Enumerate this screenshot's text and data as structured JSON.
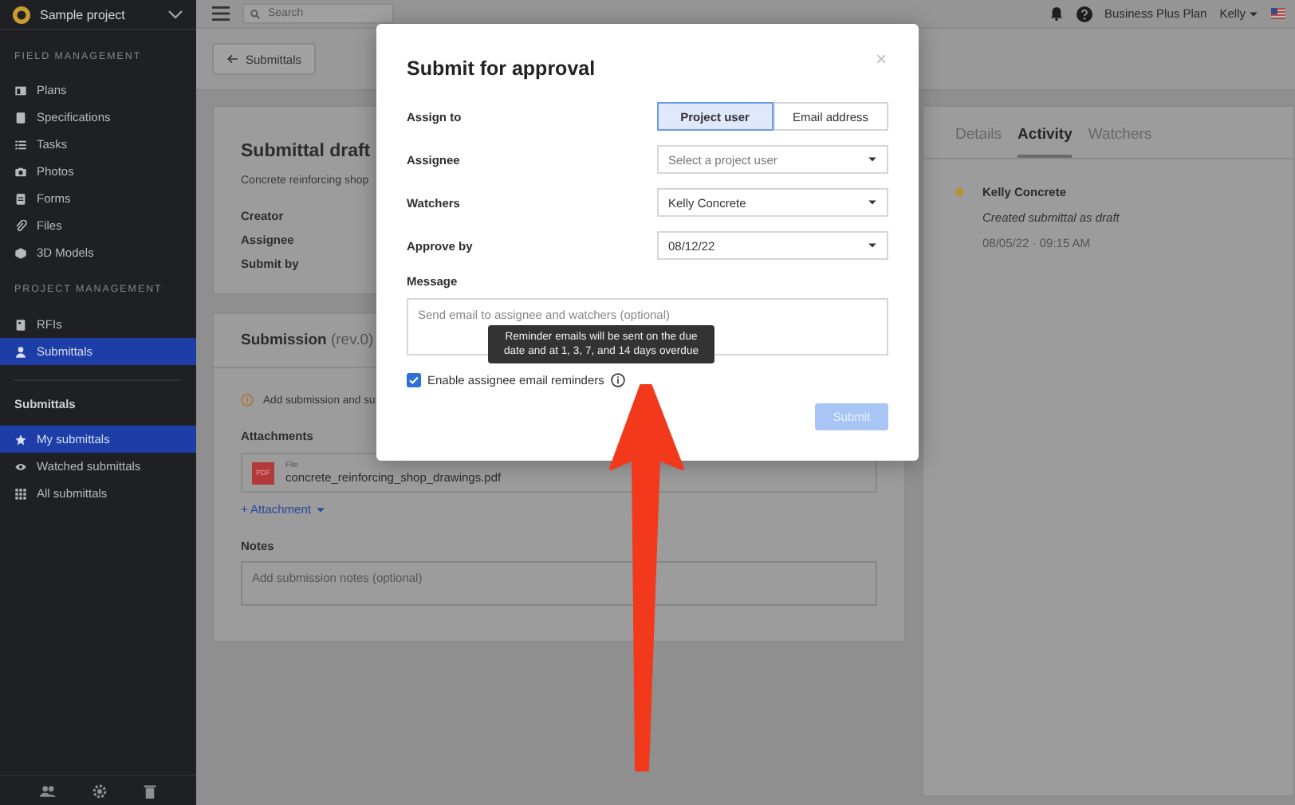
{
  "sidebar": {
    "project": "Sample project",
    "sections": [
      {
        "title": "FIELD MANAGEMENT",
        "items": [
          {
            "label": "Plans",
            "selected": false
          },
          {
            "label": "Specifications",
            "selected": false
          },
          {
            "label": "Tasks",
            "selected": false
          },
          {
            "label": "Photos",
            "selected": false
          },
          {
            "label": "Forms",
            "selected": false
          },
          {
            "label": "Files",
            "selected": false
          },
          {
            "label": "3D Models",
            "selected": false
          }
        ]
      },
      {
        "title": "PROJECT MANAGEMENT",
        "items": [
          {
            "label": "RFIs",
            "selected": false
          },
          {
            "label": "Submittals",
            "selected": true
          }
        ]
      }
    ],
    "subnav": {
      "title": "Submittals",
      "items": [
        {
          "label": "My submittals",
          "selected": true
        },
        {
          "label": "Watched submittals",
          "selected": false
        },
        {
          "label": "All submittals",
          "selected": false
        }
      ]
    }
  },
  "topbar": {
    "search": {
      "placeholder": "Search"
    },
    "plan": "Business Plus Plan",
    "user": "Kelly"
  },
  "back_button": "Submittals",
  "submittal": {
    "title": "Submittal draft",
    "subtitle": "Concrete reinforcing shop",
    "fields": [
      "Creator",
      "Assignee",
      "Submit by"
    ]
  },
  "submission": {
    "title": "Submission",
    "revision": "(rev.0)",
    "notice": "Add submission and su",
    "attachments_label": "Attachments",
    "file": {
      "type": "PDF",
      "caption": "File",
      "name": "concrete_reinforcing_shop_drawings.pdf"
    },
    "add_attachment": "+ Attachment",
    "notes_label": "Notes",
    "notes_placeholder": "Add submission notes (optional)"
  },
  "activity_panel": {
    "tabs": [
      {
        "label": "Details",
        "selected": false
      },
      {
        "label": "Activity",
        "selected": true
      },
      {
        "label": "Watchers",
        "selected": false
      }
    ],
    "entries": [
      {
        "author": "Kelly Concrete",
        "action": "Created submittal as draft",
        "time": "08/05/22 · 09:15 AM"
      }
    ]
  },
  "dialog": {
    "title": "Submit for approval",
    "close": "×",
    "assign_to": {
      "label": "Assign to",
      "options": [
        {
          "label": "Project user",
          "selected": true
        },
        {
          "label": "Email address",
          "selected": false
        }
      ]
    },
    "fields": [
      {
        "label": "Assignee",
        "placeholder": "Select a project user"
      },
      {
        "label": "Watchers",
        "value": "Kelly Concrete"
      },
      {
        "label": "Approve by",
        "value": "08/12/22"
      }
    ],
    "message": {
      "label": "Message",
      "placeholder": "Send email to assignee and watchers (optional)"
    },
    "reminders": {
      "label": "Enable assignee email reminders",
      "checked": true
    },
    "tooltip": "Reminder emails will be sent on the due date and at 1, 3, 7, and 14 days overdue",
    "submit": {
      "label": "Submit",
      "disabled": true
    }
  }
}
